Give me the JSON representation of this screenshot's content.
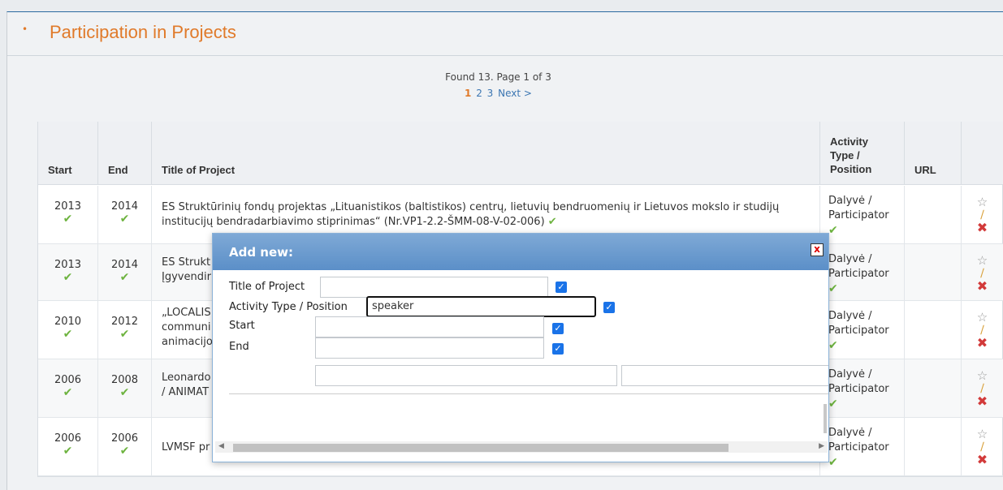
{
  "panel": {
    "collapse_glyph": "•",
    "title": "Participation in Projects"
  },
  "pagination": {
    "found_text": "Found 13. Page 1 of 3",
    "current": "1",
    "pages": [
      "2",
      "3"
    ],
    "next": "Next >"
  },
  "table": {
    "headers": {
      "start": "Start",
      "end": "End",
      "title": "Title of Project",
      "activity": "Activity Type / Position",
      "url": "URL"
    },
    "rows": [
      {
        "start": "2013",
        "end": "2014",
        "title": "ES Struktūrinių fondų projektas „Lituanistikos (baltistikos) centrų, lietuvių bendruomenių ir Lietuvos mokslo ir studijų institucijų bendradarbiavimo stiprinimas“ (Nr.VP1-2.2-ŠMM-08-V-02-006)",
        "activity": "Dalyvė / Participator"
      },
      {
        "start": "2013",
        "end": "2014",
        "title": "ES Strukt",
        "title2": "Įgyvendir",
        "activity": "Dalyvė / Participator"
      },
      {
        "start": "2010",
        "end": "2012",
        "title": "„LOCALIS",
        "title2": "communi",
        "title3": "animacijo",
        "activity": "Dalyvė / Participator"
      },
      {
        "start": "2006",
        "end": "2008",
        "title": "Leonardo",
        "title2": "/ ANIMAT",
        "activity": "Dalyvė / Participator"
      },
      {
        "start": "2006",
        "end": "2006",
        "title": "LVMSF pr",
        "activity": "Dalyvė / Participator"
      }
    ]
  },
  "icons": {
    "check": "✔",
    "star": "☆",
    "pencil": "∕",
    "delete": "✖"
  },
  "dialog": {
    "title": "Add new:",
    "close": "x",
    "fields": {
      "title_label": "Title of Project",
      "activity_label": "Activity Type / Position",
      "activity_value": "speaker",
      "start_label": "Start",
      "end_label": "End"
    }
  },
  "colors": {
    "accent": "#e07a2a",
    "link": "#3b76b2",
    "dialog_header": "#6b9ccf",
    "check": "#6db33f",
    "delete": "#d23a3a"
  }
}
